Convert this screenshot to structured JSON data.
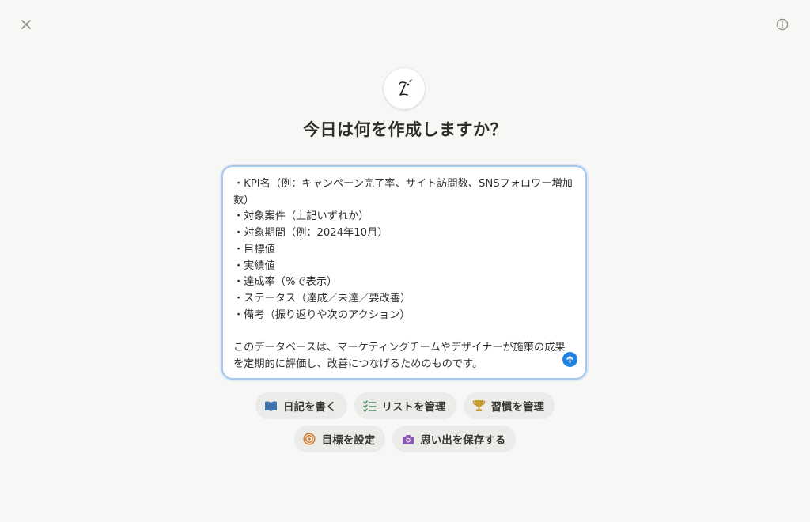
{
  "header": {
    "close_icon": "close-icon",
    "info_icon": "info-icon"
  },
  "logo": {
    "icon": "notion-ai-face-icon"
  },
  "title": "今日は何を作成しますか？",
  "prompt": {
    "text": "・KPI名（例：キャンペーン完了率、サイト訪問数、SNSフォロワー増加数）\n・対象案件（上記いずれか）\n・対象期間（例：2024年10月）\n・目標値\n・実績値\n・達成率（%で表示）\n・ステータス（達成／未達／要改善）\n・備考（振り返りや次のアクション）\n\nこのデータベースは、マーケティングチームやデザイナーが施策の成果を定期的に評価し、改善につなげるためのものです。",
    "send_icon": "arrow-up-icon"
  },
  "suggestions": [
    {
      "label": "日記を書く",
      "icon": "book-icon",
      "color": "#3e74b0"
    },
    {
      "label": "リストを管理",
      "icon": "checklist-icon",
      "color": "#4f8a5e"
    },
    {
      "label": "習慣を管理",
      "icon": "trophy-icon",
      "color": "#c99a2e"
    },
    {
      "label": "目標を設定",
      "icon": "target-icon",
      "color": "#d9792b"
    },
    {
      "label": "思い出を保存する",
      "icon": "camera-icon",
      "color": "#8a57b8"
    }
  ],
  "colors": {
    "background": "#f7f7f5",
    "accent": "#2383e2",
    "input_border": "#a7c7ec",
    "chip_bg": "#ebebea"
  }
}
